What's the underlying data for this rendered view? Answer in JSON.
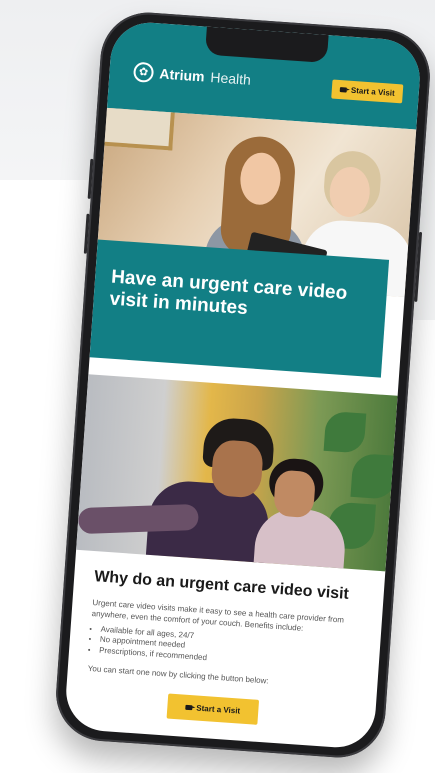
{
  "brand": {
    "name_bold": "Atrium",
    "name_light": "Health",
    "logo_icon": "tree-icon"
  },
  "header": {
    "start_visit_label": "Start a Visit",
    "button_icon": "video-camera-icon"
  },
  "hero": {
    "title": "Have an urgent care video visit in minutes"
  },
  "section": {
    "heading": "Why do an urgent care video visit",
    "intro": "Urgent care video visits make it easy to see a health care provider from anywhere, even the comfort of your couch. Benefits include:",
    "benefits": [
      "Available for all ages, 24/7",
      "No appointment needed",
      "Prescriptions, if recommended"
    ],
    "cta_text": "You can start one now by clicking the button below:",
    "start_visit_label": "Start a Visit"
  },
  "colors": {
    "teal": "#127f85",
    "yellow": "#f2c230",
    "phone_frame": "#1b1b1d"
  }
}
